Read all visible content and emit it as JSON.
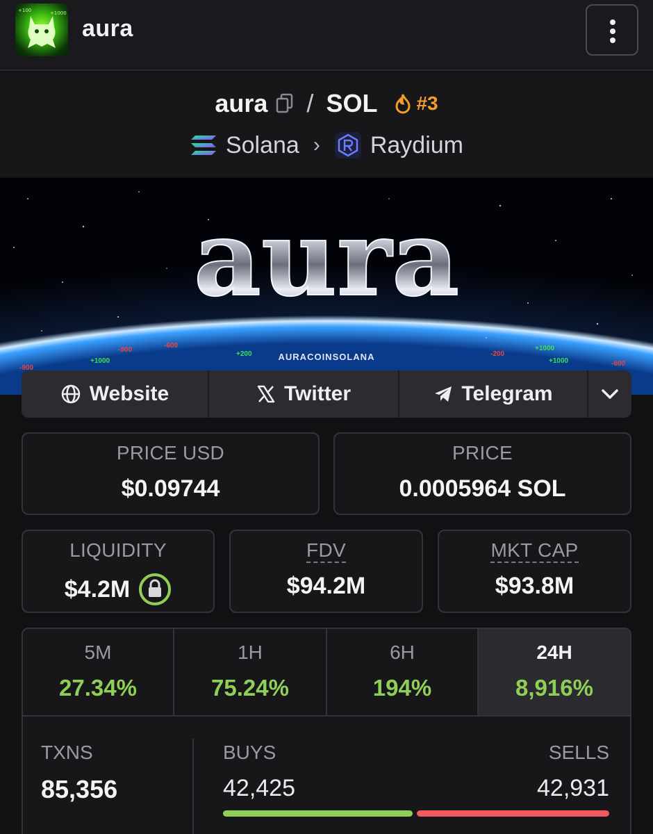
{
  "header": {
    "brand": "aura",
    "menu_icon": "kebab-menu-icon"
  },
  "pair": {
    "base": "aura",
    "separator": "/",
    "quote": "SOL",
    "rank": "#3",
    "chain": "Solana",
    "dex": "Raydium"
  },
  "banner": {
    "title": "aura",
    "footer": "AURACOINSOLANA",
    "floating_numbers": [
      "-900",
      "+1000",
      "-900",
      "-600",
      "+200",
      "-200",
      "+1000",
      "-600",
      "+1000"
    ]
  },
  "social": {
    "website": "Website",
    "twitter": "Twitter",
    "telegram": "Telegram"
  },
  "stats": {
    "price_usd_label": "PRICE USD",
    "price_usd": "$0.09744",
    "price_label": "PRICE",
    "price": "0.0005964 SOL",
    "liquidity_label": "LIQUIDITY",
    "liquidity": "$4.2M",
    "fdv_label": "FDV",
    "fdv": "$94.2M",
    "mktcap_label": "MKT CAP",
    "mktcap": "$93.8M"
  },
  "timeframes": [
    {
      "label": "5M",
      "change": "27.34%"
    },
    {
      "label": "1H",
      "change": "75.24%"
    },
    {
      "label": "6H",
      "change": "194%"
    },
    {
      "label": "24H",
      "change": "8,916%"
    }
  ],
  "active_timeframe": "24H",
  "txns": {
    "label": "TXNS",
    "total": "85,356",
    "buys_label": "BUYS",
    "buys": "42,425",
    "sells_label": "SELLS",
    "sells": "42,931",
    "buy_fraction": 0.497
  },
  "colors": {
    "positive": "#8fcf58",
    "negative": "#f05a5e",
    "rank": "#f29d2d",
    "background": "#111114"
  }
}
